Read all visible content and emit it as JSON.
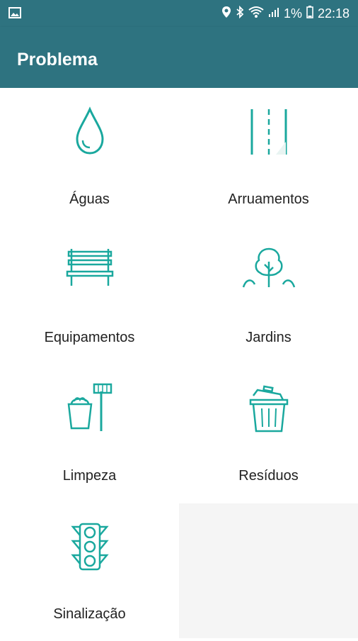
{
  "status_bar": {
    "battery_percent": "1%",
    "time": "22:18",
    "icons": [
      "image-notification-icon",
      "location-icon",
      "bluetooth-icon",
      "wifi-icon",
      "signal-icon",
      "battery-icon"
    ]
  },
  "app_bar": {
    "title": "Problema"
  },
  "colors": {
    "primary": "#2e7380",
    "icon_teal": "#1aa89e"
  },
  "categories": [
    {
      "label": "Águas",
      "icon": "water-drop-icon"
    },
    {
      "label": "Arruamentos",
      "icon": "road-icon"
    },
    {
      "label": "Equipamentos",
      "icon": "bench-icon"
    },
    {
      "label": "Jardins",
      "icon": "tree-icon"
    },
    {
      "label": "Limpeza",
      "icon": "cleaning-bucket-broom-icon"
    },
    {
      "label": "Resíduos",
      "icon": "trash-can-icon"
    },
    {
      "label": "Sinalização",
      "icon": "traffic-light-icon"
    }
  ]
}
